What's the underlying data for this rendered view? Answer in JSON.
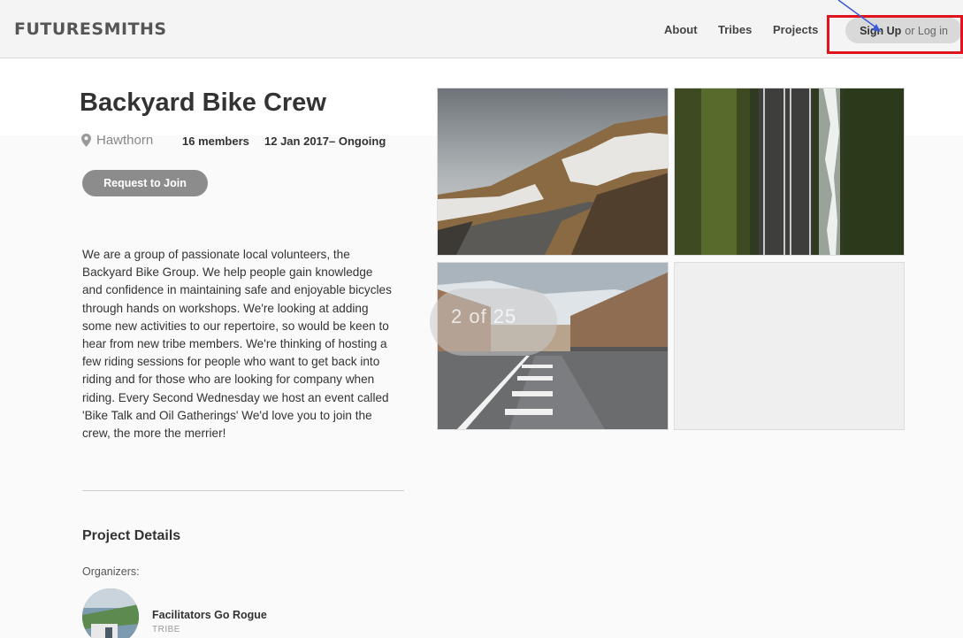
{
  "header": {
    "logo": "FUTURESMITHS",
    "nav": [
      "About",
      "Tribes",
      "Projects"
    ],
    "signup_label": "Sign Up",
    "login_label": "or Log in"
  },
  "project": {
    "title": "Backyard Bike Crew",
    "location": "Hawthorn",
    "members": "16 members",
    "dates": "12 Jan 2017– Ongoing",
    "join_label": "Request to Join",
    "description": "We are a group of passionate local volunteers, the Backyard Bike Group. We help people gain knowledge and confidence in maintaining safe and enjoyable bicycles through hands on workshops. We're looking at adding some new activities to our repertoire, so would be keen to hear from new tribe members. We're thinking of hosting a few riding sessions for people who want to get back into riding and for those who are looking for company when riding. Every Second Wednesday we host an event called 'Bike Talk and Oil Gatherings' We'd love you to join the crew, the more the merrier!"
  },
  "gallery": {
    "counter": "2 of 25",
    "photos": [
      "mountain-road-photo",
      "aerial-highway-photo",
      "city-street-photo"
    ]
  },
  "details": {
    "section_title": "Project Details",
    "organizers_label": "Organizers:",
    "organizer_name": "Facilitators Go Rogue",
    "organizer_type": "TRIBE"
  },
  "colors": {
    "highlight": "#e0141e",
    "arrow": "#3b5bd6",
    "button_gray": "#8c8c8c"
  }
}
